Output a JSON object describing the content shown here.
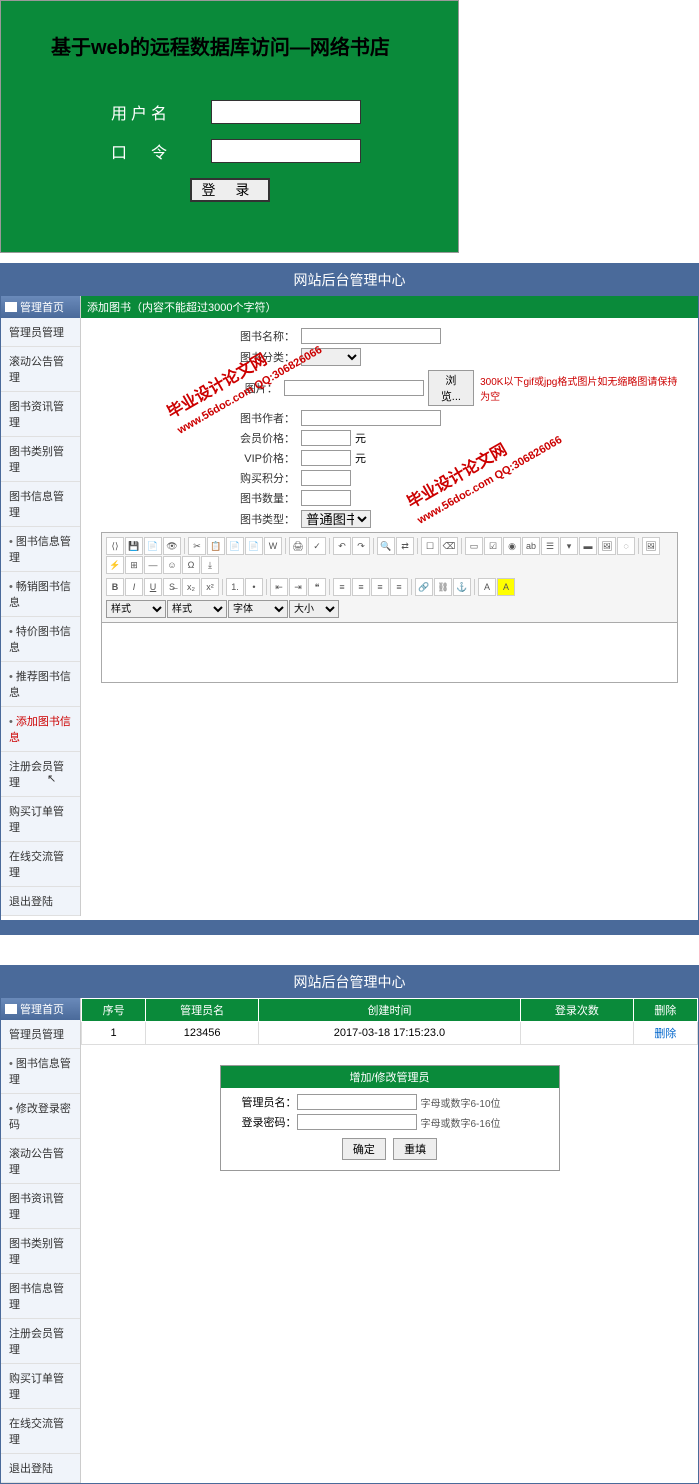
{
  "login": {
    "title": "基于web的远程数据库访问—网络书店",
    "username_label": "用户名",
    "password_label": "口　令",
    "submit_label": "登 录"
  },
  "admin_header": "网站后台管理中心",
  "sidebar1": {
    "header": "管理首页",
    "items": [
      {
        "label": "管理员管理",
        "bullet": false
      },
      {
        "label": "滚动公告管理",
        "bullet": false
      },
      {
        "label": "图书资讯管理",
        "bullet": false
      },
      {
        "label": "图书类别管理",
        "bullet": false
      },
      {
        "label": "图书信息管理",
        "bullet": false
      },
      {
        "label": "图书信息管理",
        "bullet": true
      },
      {
        "label": "畅销图书信息",
        "bullet": true
      },
      {
        "label": "特价图书信息",
        "bullet": true
      },
      {
        "label": "推荐图书信息",
        "bullet": true
      },
      {
        "label": "添加图书信息",
        "bullet": true,
        "active": true
      },
      {
        "label": "注册会员管理",
        "bullet": false
      },
      {
        "label": "购买订单管理",
        "bullet": false
      },
      {
        "label": "在线交流管理",
        "bullet": false
      },
      {
        "label": "退出登陆",
        "bullet": false
      }
    ]
  },
  "sidebar2": {
    "header": "管理首页",
    "items": [
      {
        "label": "管理员管理",
        "bullet": false
      },
      {
        "label": "图书信息管理",
        "bullet": true
      },
      {
        "label": "修改登录密码",
        "bullet": true
      },
      {
        "label": "滚动公告管理",
        "bullet": false
      },
      {
        "label": "图书资讯管理",
        "bullet": false
      },
      {
        "label": "图书类别管理",
        "bullet": false
      },
      {
        "label": "图书信息管理",
        "bullet": false
      },
      {
        "label": "注册会员管理",
        "bullet": false
      },
      {
        "label": "购买订单管理",
        "bullet": false
      },
      {
        "label": "在线交流管理",
        "bullet": false
      },
      {
        "label": "退出登陆",
        "bullet": false
      }
    ]
  },
  "add_book": {
    "bar": "添加图书（内容不能超过3000个字符）",
    "fields": {
      "name": "图书名称：",
      "category": "图书分类：",
      "image": "图片：",
      "browse": "浏览...",
      "image_hint": "300K以下gif或jpg格式图片如无缩略图请保持为空",
      "author": "图书作者：",
      "member_price": "会员价格：",
      "vip_price": "VIP价格：",
      "points": "购买积分：",
      "quantity": "图书数量：",
      "type": "图书类型：",
      "type_value": "普通图书",
      "unit_yuan": "元"
    }
  },
  "toolbar": {
    "font_label": "样式",
    "font2_label": "字体",
    "size_label": "大小"
  },
  "watermark": {
    "line1": "毕业设计论文网",
    "line2": "www.56doc.com   QQ:306826066"
  },
  "table": {
    "headers": [
      "序号",
      "管理员名",
      "创建时间",
      "登录次数",
      "删除"
    ],
    "rows": [
      [
        "1",
        "123456",
        "2017-03-18 17:15:23.0",
        "",
        "删除"
      ]
    ]
  },
  "add_admin": {
    "header": "增加/修改管理员",
    "name_label": "管理员名：",
    "name_hint": "字母或数字6-10位",
    "pwd_label": "登录密码：",
    "pwd_hint": "字母或数字6-16位",
    "confirm": "确定",
    "reset": "重填"
  }
}
